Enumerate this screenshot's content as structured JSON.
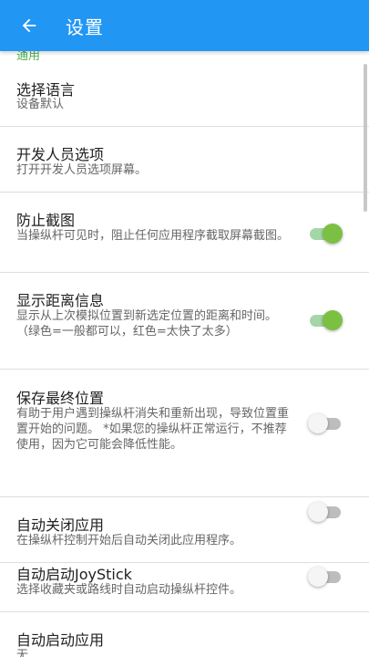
{
  "appbar": {
    "title": "设置",
    "back_icon": "arrow-left-icon"
  },
  "category": {
    "label": "通用"
  },
  "items": [
    {
      "title": "选择语言",
      "summary": "设备默认"
    },
    {
      "title": "开发人员选项",
      "summary": "打开开发人员选项屏幕。"
    },
    {
      "title": "防止截图",
      "summary": "当操纵杆可见时，阻止任何应用程序截取屏幕截图。",
      "switch": "on"
    },
    {
      "title": "显示距离信息",
      "summary": "显示从上次模拟位置到新选定位置的距离和时间。 （绿色=一般都可以，红色=太快了太多）",
      "switch": "on"
    },
    {
      "title": "保存最终位置",
      "summary": "有助于用户遇到操纵杆消失和重新出现，导致位置重置开始的问题。 *如果您的操纵杆正常运行，不推荐使用，因为它可能会降低性能。",
      "switch": "off"
    },
    {
      "title": "自动关闭应用",
      "summary": "在操纵杆控制开始后自动关闭此应用程序。",
      "switch": "off"
    },
    {
      "title": "自动启动JoyStick",
      "summary": "选择收藏夹或路线时自动启动操纵杆控件。",
      "switch": "off"
    },
    {
      "title": "自动启动应用",
      "summary": "无"
    }
  ],
  "colors": {
    "primary": "#2196F3",
    "accent": "#7cc043",
    "category": "#4CAF50"
  }
}
